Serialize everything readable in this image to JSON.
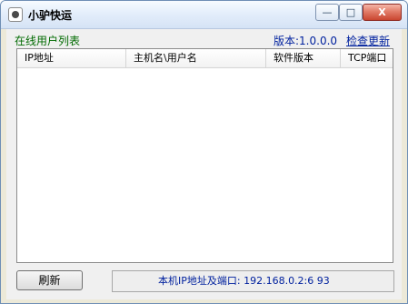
{
  "window": {
    "title": "小驴快运",
    "icon": "app-icon",
    "controls": {
      "minimize": "—",
      "maximize": "□",
      "close": "X"
    }
  },
  "header": {
    "online_label": "在线用户列表",
    "version": "版本:1.0.0.0",
    "check_update": "检查更新"
  },
  "table": {
    "columns": [
      "IP地址",
      "主机名\\用户名",
      "软件版本",
      "TCP端口"
    ]
  },
  "footer": {
    "refresh_label": "刷新",
    "status_text": "本机IP地址及端口: 192.168.0.2:6 93"
  }
}
